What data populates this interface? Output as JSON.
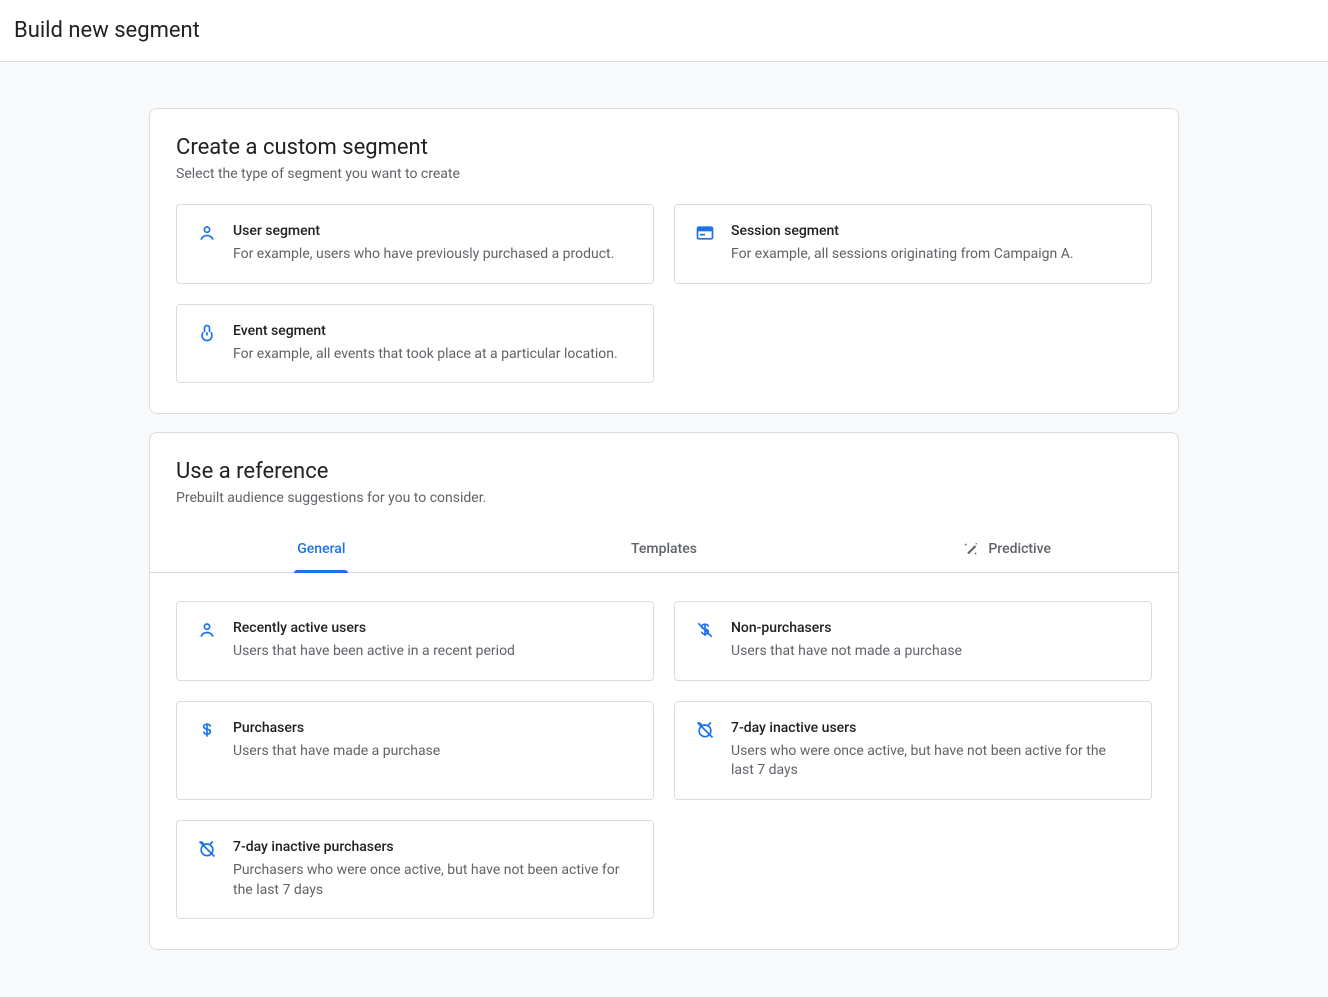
{
  "header": {
    "title": "Build new segment"
  },
  "custom": {
    "title": "Create a custom segment",
    "subtitle": "Select the type of segment you want to create",
    "options": [
      {
        "title": "User segment",
        "desc": "For example, users who have previously purchased a product.",
        "icon": "user-icon"
      },
      {
        "title": "Session segment",
        "desc": "For example, all sessions originating from Campaign A.",
        "icon": "session-icon"
      },
      {
        "title": "Event segment",
        "desc": "For example, all events that took place at a particular location.",
        "icon": "event-icon"
      }
    ]
  },
  "reference": {
    "title": "Use a reference",
    "subtitle": "Prebuilt audience suggestions for you to consider.",
    "tabs": [
      {
        "label": "General",
        "active": true
      },
      {
        "label": "Templates",
        "active": false
      },
      {
        "label": "Predictive",
        "active": false,
        "icon": "wand-icon"
      }
    ],
    "items": [
      {
        "title": "Recently active users",
        "desc": "Users that have been active in a recent period",
        "icon": "user-icon"
      },
      {
        "title": "Non-purchasers",
        "desc": "Users that have not made a purchase",
        "icon": "no-dollar-icon"
      },
      {
        "title": "Purchasers",
        "desc": "Users that have made a purchase",
        "icon": "dollar-icon"
      },
      {
        "title": "7-day inactive users",
        "desc": "Users who were once active, but have not been active for the last 7 days",
        "icon": "alarm-off-icon"
      },
      {
        "title": "7-day inactive purchasers",
        "desc": "Purchasers who were once active, but have not been active for the last 7 days",
        "icon": "alarm-off-icon"
      }
    ]
  }
}
